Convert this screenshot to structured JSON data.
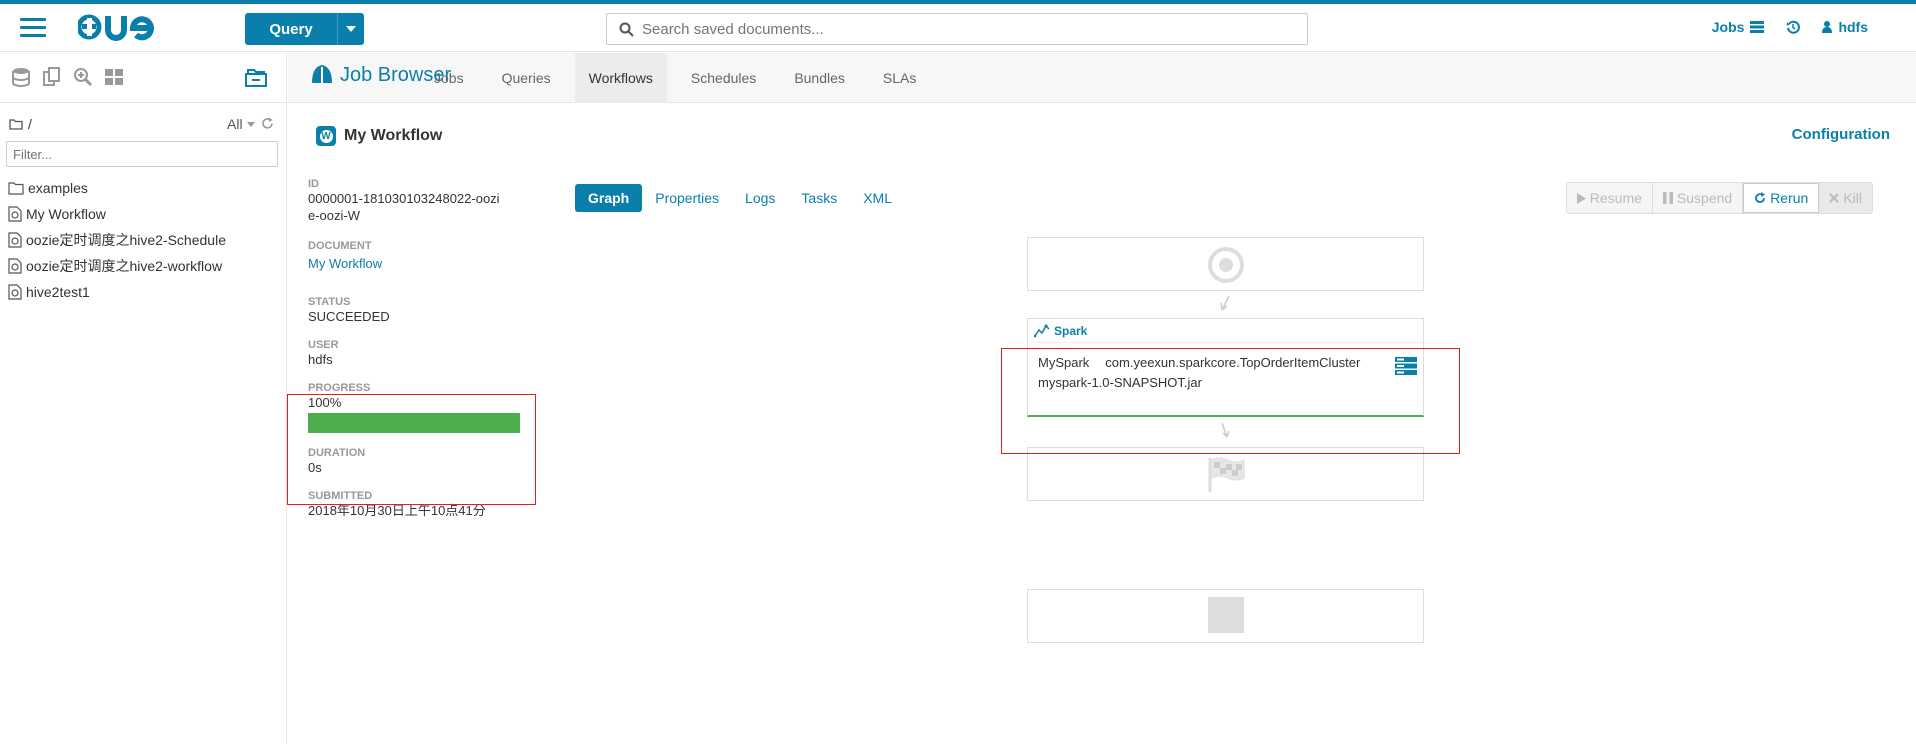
{
  "header": {
    "query_label": "Query",
    "search_placeholder": "Search saved documents...",
    "jobs_label": "Jobs",
    "user_label": "hdfs"
  },
  "sidebar": {
    "path": "/",
    "filter_value": "All",
    "filter_placeholder": "Filter...",
    "items": [
      {
        "label": "examples",
        "icon": "folder-icon"
      },
      {
        "label": "My Workflow",
        "icon": "workflow-doc-icon"
      },
      {
        "label": "oozie定时调度之hive2-Schedule",
        "icon": "workflow-doc-icon"
      },
      {
        "label": "oozie定时调度之hive2-workflow",
        "icon": "workflow-doc-icon"
      },
      {
        "label": "hive2test1",
        "icon": "workflow-doc-icon"
      }
    ]
  },
  "jobbrowser": {
    "title": "Job Browser",
    "tabs": [
      {
        "label": "Jobs",
        "active": false
      },
      {
        "label": "Queries",
        "active": false
      },
      {
        "label": "Workflows",
        "active": true
      },
      {
        "label": "Schedules",
        "active": false
      },
      {
        "label": "Bundles",
        "active": false
      },
      {
        "label": "SLAs",
        "active": false
      }
    ]
  },
  "workflow": {
    "badge": "W",
    "title": "My Workflow",
    "configuration_label": "Configuration",
    "id_label": "ID",
    "id_line1": "0000001-181030103248022-oozi",
    "id_line2": "e-oozi-W",
    "document_label": "DOCUMENT",
    "document": "My Workflow",
    "status_label": "STATUS",
    "status": "SUCCEEDED",
    "user_label": "USER",
    "user": "hdfs",
    "progress_label": "PROGRESS",
    "progress": "100%",
    "progress_fraction": 1.0,
    "duration_label": "DURATION",
    "duration": "0s",
    "submitted_label": "SUBMITTED",
    "submitted": "2018年10月30日上午10点41分"
  },
  "subtabs": [
    {
      "label": "Graph",
      "active": true
    },
    {
      "label": "Properties",
      "active": false
    },
    {
      "label": "Logs",
      "active": false
    },
    {
      "label": "Tasks",
      "active": false
    },
    {
      "label": "XML",
      "active": false
    }
  ],
  "actions": {
    "resume": "Resume",
    "suspend": "Suspend",
    "rerun": "Rerun",
    "kill": "Kill"
  },
  "graph": {
    "spark_label": "Spark",
    "action_name": "MySpark",
    "action_class": "com.yeexun.sparkcore.TopOrderItemCluster",
    "action_jar": "myspark-1.0-SNAPSHOT.jar"
  },
  "colors": {
    "accent": "#0b7fab",
    "success": "#4cae4c",
    "highlight": "#e0201a"
  }
}
